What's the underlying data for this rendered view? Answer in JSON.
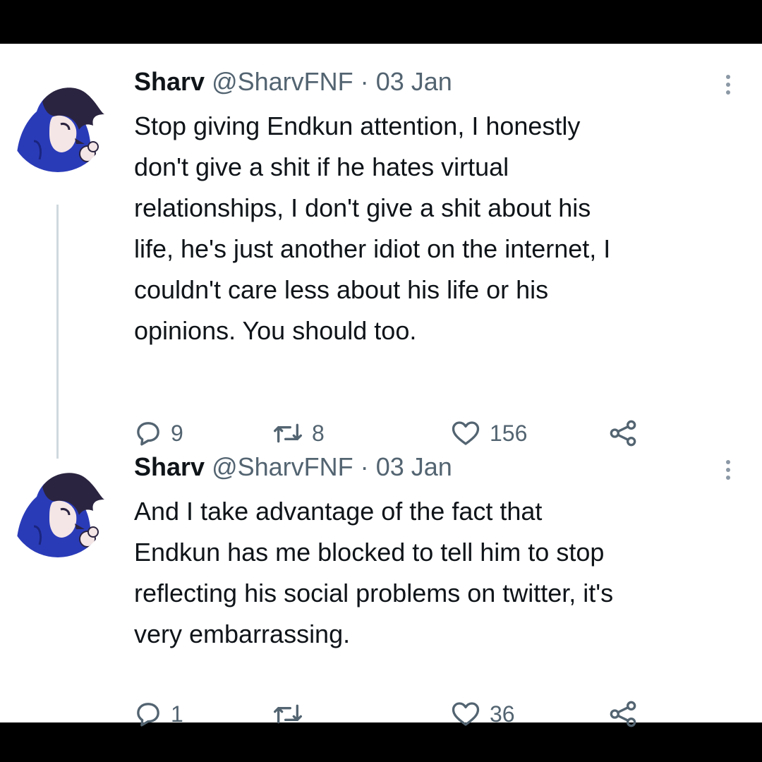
{
  "tweets": [
    {
      "author": {
        "name": "Sharv",
        "handle": "@SharvFNF",
        "date": "03 Jan",
        "separator": "·"
      },
      "text_lines": [
        "Stop giving Endkun attention, I honestly",
        "don't give a shit if he hates virtual",
        "relationships, I don't give a shit about his",
        "life, he's just another idiot on the internet, I",
        "couldn't care less about his life or his",
        "opinions. You should too."
      ],
      "replies": "9",
      "retweets": "8",
      "likes": "156",
      "icons": {
        "avatar": "hooded-character-avatar",
        "more": "more-vertical-icon",
        "reply": "reply-icon",
        "retweet": "retweet-icon",
        "like": "heart-icon",
        "share": "share-icon"
      }
    },
    {
      "author": {
        "name": "Sharv",
        "handle": "@SharvFNF",
        "date": "03 Jan",
        "separator": "·"
      },
      "text_lines": [
        "And I take advantage of the fact that",
        "Endkun has me blocked to tell him to stop",
        "reflecting his social problems on twitter, it's",
        "very embarrassing."
      ],
      "replies": "1",
      "retweets": "",
      "likes": "36",
      "icons": {
        "avatar": "hooded-character-avatar",
        "more": "more-vertical-icon",
        "reply": "reply-icon",
        "retweet": "retweet-icon",
        "like": "heart-icon",
        "share": "share-icon"
      }
    }
  ],
  "colors": {
    "background": "#000000",
    "card": "#ffffff",
    "text_primary": "#0f1419",
    "text_secondary": "#536471",
    "thread_line": "#cfd9de",
    "avatar_hood": "#2a3bb8",
    "avatar_hair": "#2b2440"
  }
}
